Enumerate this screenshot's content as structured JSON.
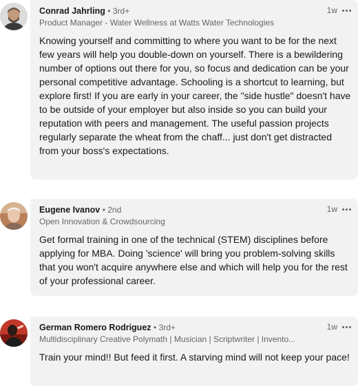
{
  "comments": [
    {
      "name": "Conrad Jahrling",
      "degree": "• 3rd+",
      "headline": "Product Manager - Water Wellness at Watts Water Technologies",
      "time": "1w",
      "text": "Knowing yourself and committing to where you want to be for the next few years will help you double-down on yourself. There is a bewildering number of options out there for you, so focus and dedication can be your personal competitive advantage. Schooling is a shortcut to learning, but explore first! If you are early in your career, the \"side hustle\" doesn't have to be outside of your employer but also inside so you can build your reputation with peers and management. The useful passion projects regularly separate the wheat from the chaff... just don't get distracted from your boss's expectations."
    },
    {
      "name": "Eugene Ivanov",
      "degree": "• 2nd",
      "headline": "Open Innovation & Crowdsourcing",
      "time": "1w",
      "text": "Get formal training in one of the technical (STEM) disciplines before applying for MBA. Doing 'science' will bring you problem-solving skills that you won't acquire anywhere else and which will help you for the rest of your professional career."
    },
    {
      "name": "German Romero Rodriguez",
      "degree": "• 3rd+",
      "headline": "Multidisciplinary Creative Polymath | Musician | Scriptwriter | Invento...",
      "time": "1w",
      "text": "Train your mind!! But feed it first. A starving mind will not keep your pace!"
    }
  ]
}
